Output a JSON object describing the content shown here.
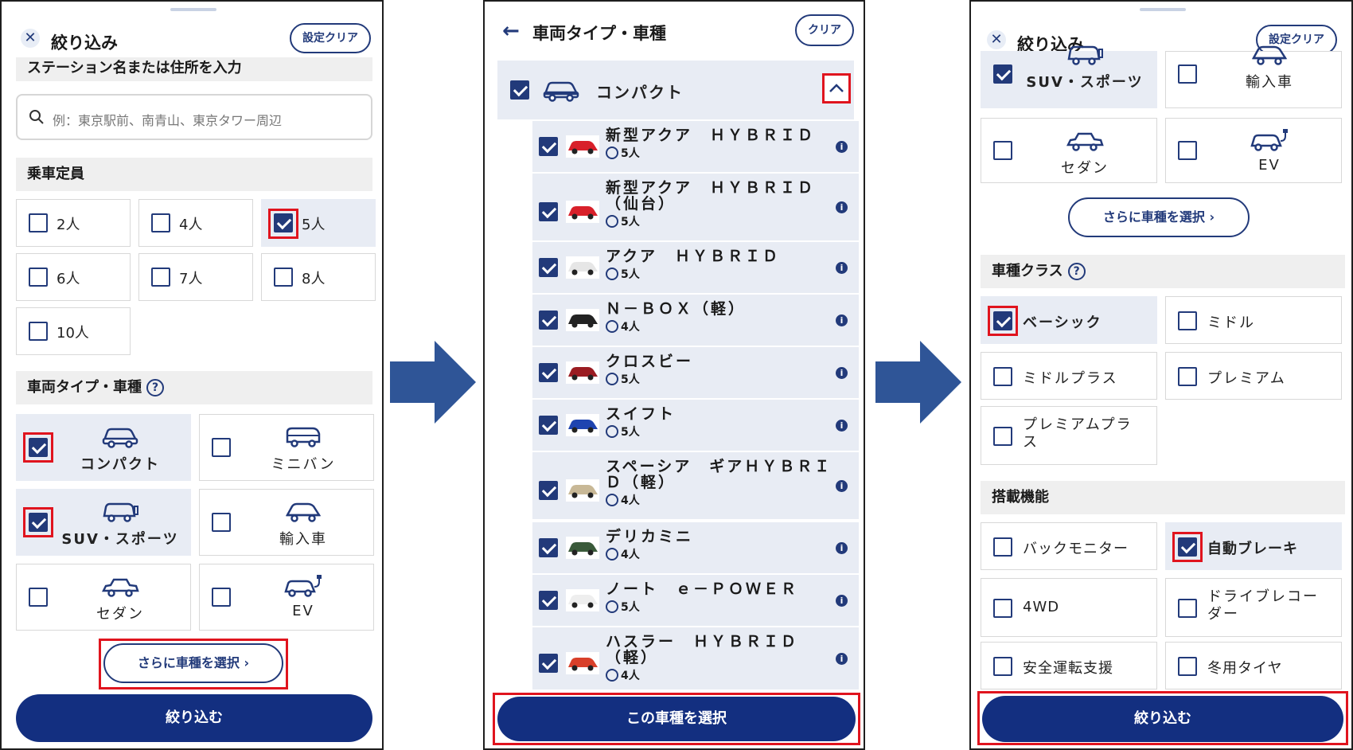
{
  "panel1": {
    "title": "絞り込み",
    "clear_label": "設定クリア",
    "station_section": "ステーション名または住所を入力",
    "search_placeholder": "例：東京駅前、南青山、東京タワー周辺",
    "capacity_section": "乗車定員",
    "capacity_options": [
      "2人",
      "4人",
      "5人",
      "6人",
      "7人",
      "8人",
      "10人"
    ],
    "capacity_checked": [
      false,
      false,
      true,
      false,
      false,
      false,
      false
    ],
    "vehicle_section": "車両タイプ・車種",
    "vehicle_types": [
      "コンパクト",
      "ミニバン",
      "SUV・スポーツ",
      "輸入車",
      "セダン",
      "EV"
    ],
    "vehicle_checked": [
      true,
      false,
      true,
      false,
      false,
      false
    ],
    "more_button": "さらに車種を選択",
    "apply_button": "絞り込む"
  },
  "panel2": {
    "title": "車両タイプ・車種",
    "clear_label": "クリア",
    "category": "コンパクト",
    "cars": [
      {
        "name_line1": "新型アクア　ＨＹＢＲＩＤ",
        "name_line2": "",
        "seats": "5人",
        "color": "#d8202a"
      },
      {
        "name_line1": "新型アクア　ＨＹＢＲＩＤ",
        "name_line2": "（仙台）",
        "seats": "5人",
        "color": "#d8202a"
      },
      {
        "name_line1": "アクア　ＨＹＢＲＩＤ",
        "name_line2": "",
        "seats": "5人",
        "color": "#e6e6e6"
      },
      {
        "name_line1": "Ｎ－ＢＯＸ（軽）",
        "name_line2": "",
        "seats": "4人",
        "color": "#222222"
      },
      {
        "name_line1": "クロスビー",
        "name_line2": "",
        "seats": "5人",
        "color": "#9a1c22"
      },
      {
        "name_line1": "スイフト",
        "name_line2": "",
        "seats": "5人",
        "color": "#1e44b0"
      },
      {
        "name_line1": "スペーシア　ギアＨＹＢＲＩ",
        "name_line2": "Ｄ（軽）",
        "seats": "4人",
        "color": "#c8b896"
      },
      {
        "name_line1": "デリカミニ",
        "name_line2": "",
        "seats": "4人",
        "color": "#3a5a3a"
      },
      {
        "name_line1": "ノート　ｅ－ＰＯＷＥＲ",
        "name_line2": "",
        "seats": "5人",
        "color": "#eeeeee"
      },
      {
        "name_line1": "ハスラー　ＨＹＢＲＩＤ",
        "name_line2": "（軽）",
        "seats": "4人",
        "color": "#d8402a"
      }
    ],
    "select_button": "この車種を選択"
  },
  "panel3": {
    "title": "絞り込み",
    "clear_label": "設定クリア",
    "vehicle_types": [
      "SUV・スポーツ",
      "輸入車",
      "セダン",
      "EV"
    ],
    "vehicle_checked": [
      true,
      false,
      false,
      false
    ],
    "more_button": "さらに車種を選択",
    "class_section": "車種クラス",
    "classes": [
      "ベーシック",
      "ミドル",
      "ミドルプラス",
      "プレミアム",
      "プレミアムプラス"
    ],
    "class_checked": [
      true,
      false,
      false,
      false,
      false
    ],
    "feature_section": "搭載機能",
    "features": [
      "バックモニター",
      "自動ブレーキ",
      "4WD",
      "ドライブレコーダー",
      "安全運転支援",
      "冬用タイヤ"
    ],
    "feature_checked": [
      false,
      true,
      false,
      false,
      false,
      false
    ],
    "apply_button": "絞り込む"
  },
  "colors": {
    "primary": "#132f80",
    "highlight": "#e0141e",
    "selected_bg": "#e8ecf4"
  }
}
